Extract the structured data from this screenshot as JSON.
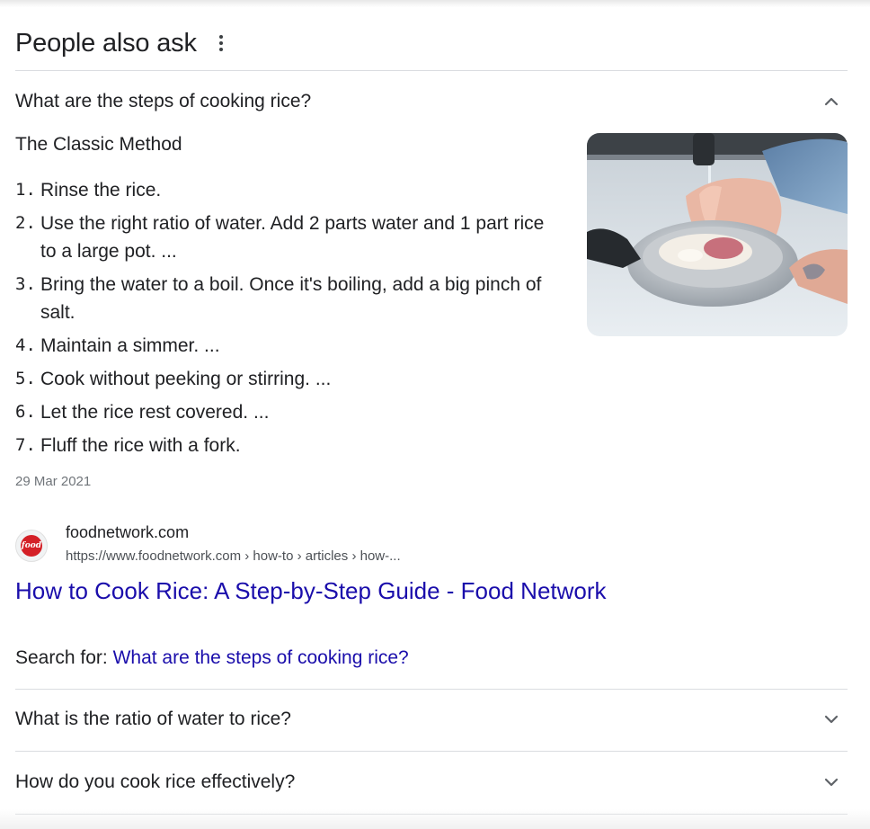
{
  "header": {
    "title": "People also ask"
  },
  "questions": [
    {
      "text": "What are the steps of cooking rice?",
      "expanded": true
    },
    {
      "text": "What is the ratio of water to rice?",
      "expanded": false
    },
    {
      "text": "How do you cook rice effectively?",
      "expanded": false
    }
  ],
  "answer": {
    "title": "The Classic Method",
    "steps": [
      {
        "num": "1.",
        "text": "Rinse the rice."
      },
      {
        "num": "2.",
        "text": "Use the right ratio of water. Add 2 parts water and 1 part rice to a large pot. ..."
      },
      {
        "num": "3.",
        "text": "Bring the water to a boil. Once it's boiling, add a big pinch of salt."
      },
      {
        "num": "4.",
        "text": "Maintain a simmer. ..."
      },
      {
        "num": "5.",
        "text": "Cook without peeking or stirring. ..."
      },
      {
        "num": "6.",
        "text": "Let the rice rest covered. ..."
      },
      {
        "num": "7.",
        "text": "Fluff the rice with a fork."
      }
    ],
    "date": "29 Mar 2021"
  },
  "source": {
    "favicon_text": "food",
    "site_name": "foodnetwork.com",
    "url": "https://www.foodnetwork.com › how-to › articles › how-...",
    "link_title": "How to Cook Rice: A Step-by-Step Guide - Food Network"
  },
  "search_for": {
    "label": "Search for: ",
    "query": "What are the steps of cooking rice?"
  },
  "icons": {
    "menu": "more-vert-icon",
    "expanded": "chevron-up-icon",
    "collapsed": "chevron-down-icon"
  },
  "colors": {
    "link": "#1a0dab",
    "text": "#202124",
    "muted": "#70757a",
    "divider": "#dadce0"
  }
}
